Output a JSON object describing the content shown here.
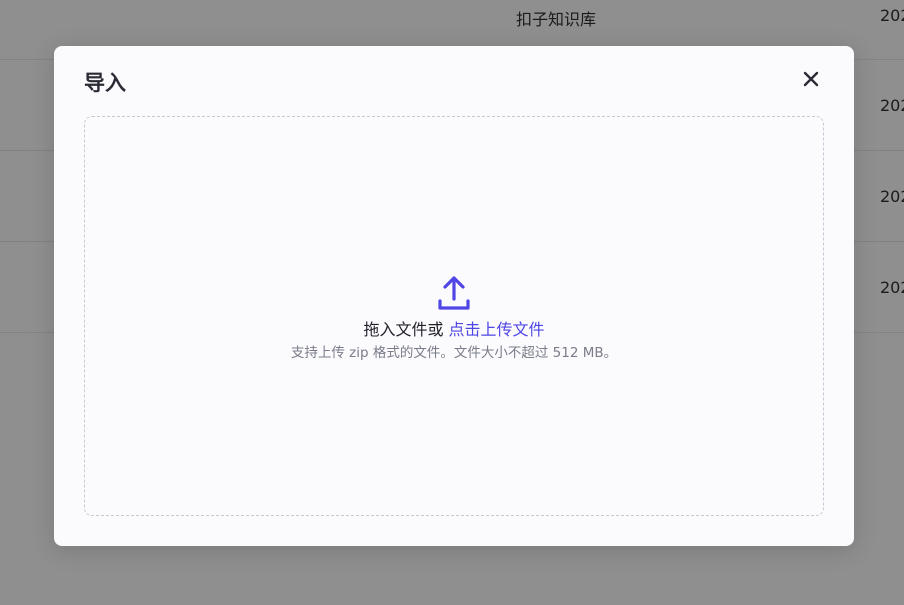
{
  "background": {
    "rows": [
      {
        "name": "扣子知识库",
        "date": "202"
      },
      {
        "name": "",
        "date": "202"
      },
      {
        "name": "",
        "date": "202"
      },
      {
        "name": "",
        "date": "202"
      }
    ]
  },
  "modal": {
    "title": "导入",
    "close_icon": "close-icon",
    "dropzone": {
      "icon": "upload-icon",
      "drag_text": "拖入文件或",
      "click_text": "点击上传文件",
      "hint": "支持上传 zip 格式的文件。文件大小不超过 512 MB。"
    }
  },
  "colors": {
    "accent": "#4f46e5",
    "title": "#2a2b35",
    "hint": "#7a7c89",
    "dashed_border": "#c8c9d6"
  }
}
